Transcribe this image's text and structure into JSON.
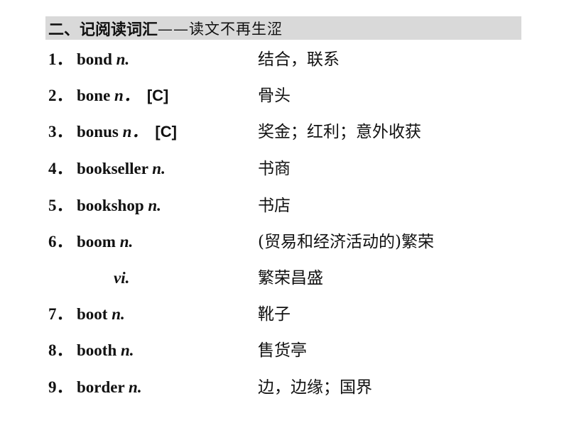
{
  "header": {
    "title": "二、记阅读词汇",
    "subtitle": "——读文不再生涩"
  },
  "entries": [
    {
      "num": "1．",
      "word": "bond ",
      "pos": "n.",
      "tag": "",
      "meaning": "结合，联系"
    },
    {
      "num": "2．",
      "word": "bone ",
      "pos": "n．",
      "tag": "[C]",
      "meaning": "骨头"
    },
    {
      "num": "3．",
      "word": "bonus ",
      "pos": "n．",
      "tag": "[C]",
      "meaning": "奖金；红利；意外收获"
    },
    {
      "num": "4．",
      "word": "bookseller ",
      "pos": "n.",
      "tag": "",
      "meaning": "书商"
    },
    {
      "num": "5．",
      "word": "bookshop ",
      "pos": "n.",
      "tag": "",
      "meaning": "书店"
    },
    {
      "num": "6．",
      "word": "boom ",
      "pos": "n.",
      "tag": "",
      "meaning": "(贸易和经济活动的)繁荣"
    },
    {
      "sub_pos": "vi.",
      "meaning": "繁荣昌盛"
    },
    {
      "num": "7．",
      "word": "boot ",
      "pos": "n.",
      "tag": "",
      "meaning": "靴子"
    },
    {
      "num": "8．",
      "word": "booth ",
      "pos": "n.",
      "tag": "",
      "meaning": "售货亭"
    },
    {
      "num": "9．",
      "word": "border ",
      "pos": "n.",
      "tag": "",
      "meaning": "边，边缘；国界"
    }
  ]
}
